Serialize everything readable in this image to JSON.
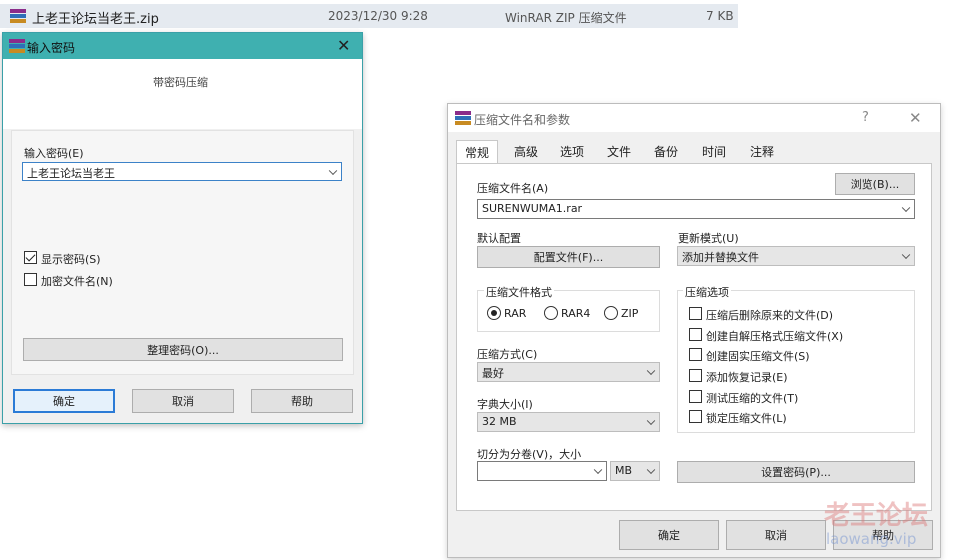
{
  "file_row": {
    "name": "上老王论坛当老王.zip",
    "date": "2023/12/30 9:28",
    "type": "WinRAR ZIP 压缩文件",
    "size": "7 KB"
  },
  "password_dialog": {
    "title": "输入密码",
    "header": "带密码压缩",
    "input_label": "输入密码(E)",
    "input_value": "上老王论坛当老王",
    "show_password_label": "显示密码(S)",
    "show_password_checked": true,
    "encrypt_names_label": "加密文件名(N)",
    "encrypt_names_checked": false,
    "manage_button": "整理密码(O)...",
    "ok_button": "确定",
    "cancel_button": "取消",
    "help_button": "帮助"
  },
  "archive_dialog": {
    "title": "压缩文件名和参数",
    "question_mark": "?",
    "tabs": [
      "常规",
      "高级",
      "选项",
      "文件",
      "备份",
      "时间",
      "注释"
    ],
    "archive_name_label": "压缩文件名(A)",
    "browse_button": "浏览(B)...",
    "archive_name_value": "SURENWUMA1.rar",
    "default_profile_label": "默认配置",
    "profiles_button": "配置文件(F)...",
    "update_mode_label": "更新模式(U)",
    "update_mode_value": "添加并替换文件",
    "format_group_label": "压缩文件格式",
    "formats": [
      "RAR",
      "RAR4",
      "ZIP"
    ],
    "selected_format": "RAR",
    "options_group_label": "压缩选项",
    "options": [
      {
        "label": "压缩后删除原来的文件(D)",
        "checked": false
      },
      {
        "label": "创建自解压格式压缩文件(X)",
        "checked": false
      },
      {
        "label": "创建固实压缩文件(S)",
        "checked": false
      },
      {
        "label": "添加恢复记录(E)",
        "checked": false
      },
      {
        "label": "测试压缩的文件(T)",
        "checked": false
      },
      {
        "label": "锁定压缩文件(L)",
        "checked": false
      }
    ],
    "method_label": "压缩方式(C)",
    "method_value": "最好",
    "dict_label": "字典大小(I)",
    "dict_value": "32 MB",
    "split_label": "切分为分卷(V)，大小",
    "split_value": "",
    "split_unit": "MB",
    "set_password_button": "设置密码(P)...",
    "ok_button": "确定",
    "cancel_button": "取消",
    "help_button": "帮助"
  },
  "watermark": {
    "text": "老王论坛",
    "sub": "laowang.vip"
  }
}
